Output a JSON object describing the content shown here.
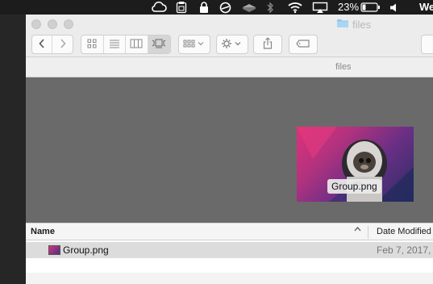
{
  "menubar": {
    "battery_percent": "23%",
    "clock_partial": "We",
    "battery_level": 0.23,
    "icons": [
      "creative-cloud-icon",
      "clipboard-icon",
      "lock-icon",
      "sync-icon",
      "drive-icon",
      "bluetooth-icon",
      "wifi-icon",
      "airplay-icon",
      "battery-icon",
      "volume-icon"
    ]
  },
  "window": {
    "title": "files",
    "path_title": "files",
    "icons": {
      "back": "chevron-left-icon",
      "forward": "chevron-right-icon",
      "view_icons": "icon-view-icon",
      "view_list": "list-view-icon",
      "view_columns": "column-view-icon",
      "view_coverflow": "coverflow-view-icon",
      "arrange": "arrange-icon",
      "action": "gear-icon",
      "share": "share-icon",
      "tags": "tag-icon",
      "title_folder": "folder-icon"
    },
    "active_view": "coverflow"
  },
  "preview": {
    "selected_label": "Group.png"
  },
  "list": {
    "columns": [
      "Name",
      "Date Modified"
    ],
    "sort_indicator": "^",
    "rows": [
      {
        "name": "Group.png",
        "date": "Feb 7, 2017,"
      }
    ]
  },
  "colors": {
    "accent_folder": "#8ec7ef",
    "preview_bg": "#6a6a6a",
    "selected_row": "#dcdcdc"
  }
}
